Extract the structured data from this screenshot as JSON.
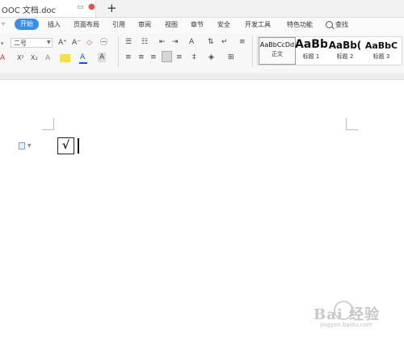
{
  "title_bar": {
    "doc_tab_title": "OOC 文档.doc",
    "new_tab_symbol": "+"
  },
  "menu": {
    "start": "开始",
    "items": [
      "插入",
      "页面布局",
      "引用",
      "审阅",
      "视图",
      "章节",
      "安全",
      "开发工具",
      "特色功能"
    ],
    "search": "查找",
    "collapse_symbol": "▿"
  },
  "toolbar": {
    "font_size_value": "二号",
    "grow_font": "A⁺",
    "shrink_font": "A⁻",
    "clear_format": "◇",
    "superscript": "X²",
    "subscript": "X₂",
    "font_color": "A",
    "char_shading": "A"
  },
  "styles": [
    {
      "sample": "AaBbCcDd",
      "label": "正文"
    },
    {
      "sample": "AaBb",
      "label": "标题 1"
    },
    {
      "sample": "AaBb(",
      "label": "标题 2"
    },
    {
      "sample": "AaBbC",
      "label": "标题 3"
    }
  ],
  "document": {
    "content": "√"
  },
  "watermark": {
    "text": "Bai 经验",
    "url": "jingyan.baidu.com"
  },
  "colors": {
    "accent": "#3b8ee8",
    "tab_close": "#d9534f"
  }
}
